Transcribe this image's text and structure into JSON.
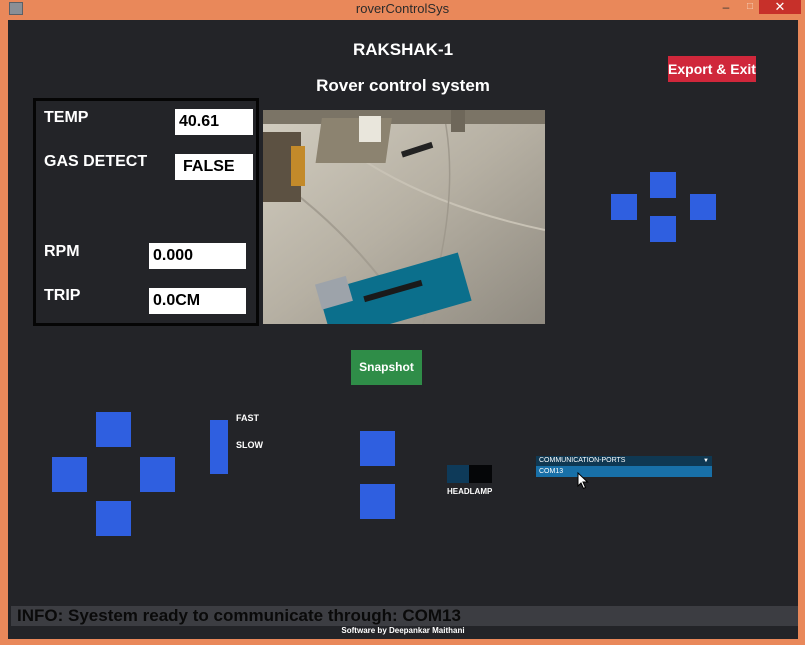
{
  "window": {
    "title": "roverControlSys",
    "minimize": "–",
    "maximize": "□",
    "close": "✕"
  },
  "header": {
    "title": "RAKSHAK-1",
    "subtitle": "Rover control system"
  },
  "export_button": "Export & Exit",
  "sensors": {
    "temp": {
      "label": "TEMP",
      "value": "40.61"
    },
    "gas": {
      "label": "GAS DETECT",
      "value": "FALSE"
    },
    "rpm": {
      "label": "RPM",
      "value": "0.000"
    },
    "trip": {
      "label": "TRIP",
      "value": "0.0CM"
    }
  },
  "snapshot_button": "Snapshot",
  "speed": {
    "fast": "FAST",
    "slow": "SLOW"
  },
  "headlamp": {
    "label": "HEADLAMP"
  },
  "ports": {
    "label": "COMMUNICATION-PORTS",
    "selected": "COM13"
  },
  "info": "INFO: Syestem ready to communicate through: COM13",
  "footer": "Software by Deepankar Maithani",
  "colors": {
    "pad": "#2f5fe0",
    "export": "#d0273b",
    "snapshot": "#2f8d48",
    "background": "#232428",
    "titlebar": "#e9885a"
  },
  "icons": {
    "camera": "camera-feed",
    "cursor": "arrow-cursor"
  }
}
